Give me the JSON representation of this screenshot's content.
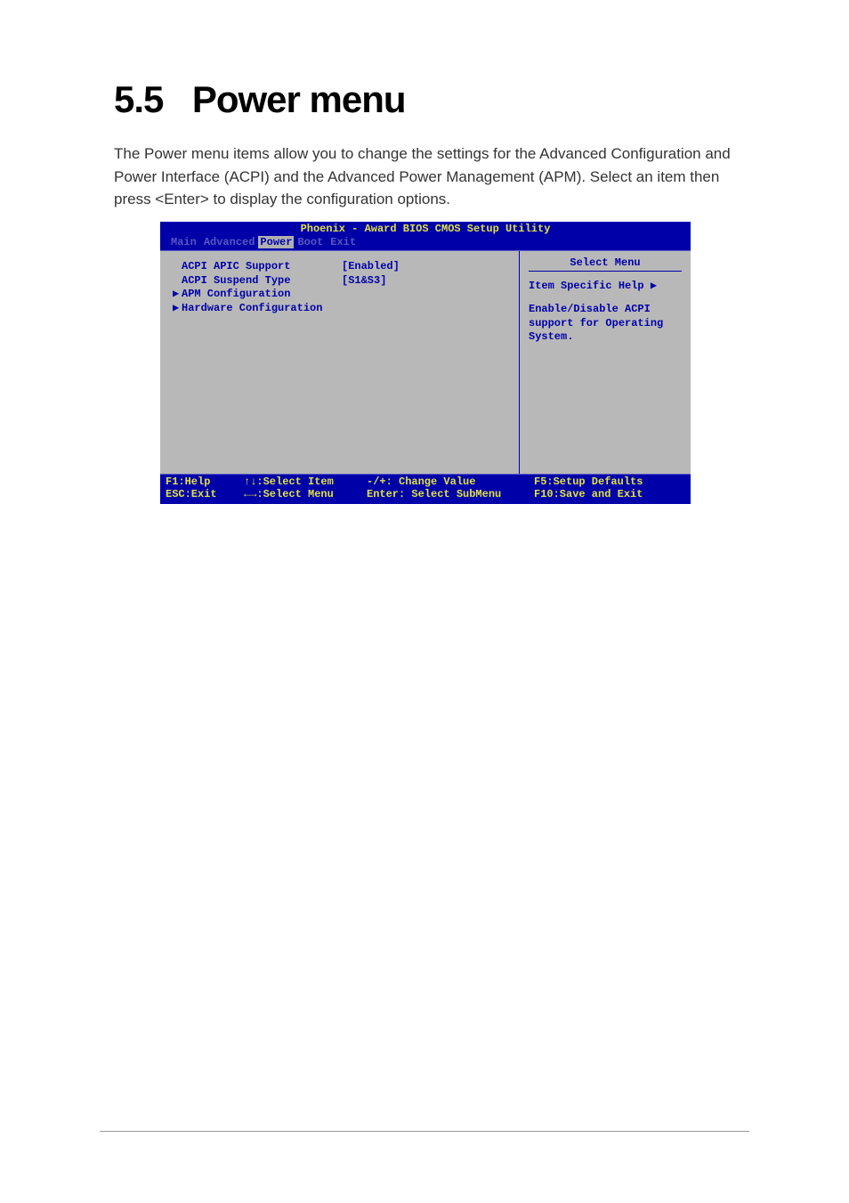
{
  "header": {
    "section_number": "5.5",
    "section_title": "Power menu"
  },
  "intro": "The Power menu items allow you to change the settings for the Advanced Configuration and Power Interface (ACPI) and the Advanced Power Management (APM). Select an item then press <Enter> to display the configuration options.",
  "bios": {
    "title": "Phoenix - Award BIOS CMOS Setup Utility",
    "tabs": {
      "main": "Main",
      "advanced": "Advanced",
      "power": "Power",
      "boot": "Boot",
      "exit": "Exit"
    },
    "items": [
      {
        "marker": "",
        "label": "ACPI APIC Support",
        "value": "[Enabled]"
      },
      {
        "marker": "",
        "label": "ACPI Suspend Type",
        "value": "[S1&S3]"
      },
      {
        "marker": "▶",
        "label": "APM Configuration",
        "value": ""
      },
      {
        "marker": "▶",
        "label": "Hardware Configuration",
        "value": ""
      }
    ],
    "help_panel": {
      "title": "Select Menu",
      "subtitle": "Item Specific Help ▶",
      "text": "Enable/Disable ACPI support for Operating System."
    },
    "footer": {
      "row1": {
        "c1": "F1:Help",
        "c2": "↑↓:Select Item",
        "c3": "-/+: Change Value",
        "c4": "F5:Setup Defaults"
      },
      "row2": {
        "c1": "ESC:Exit",
        "c2": "←→:Select Menu",
        "c3": "Enter: Select SubMenu",
        "c4": "F10:Save and Exit"
      }
    }
  }
}
